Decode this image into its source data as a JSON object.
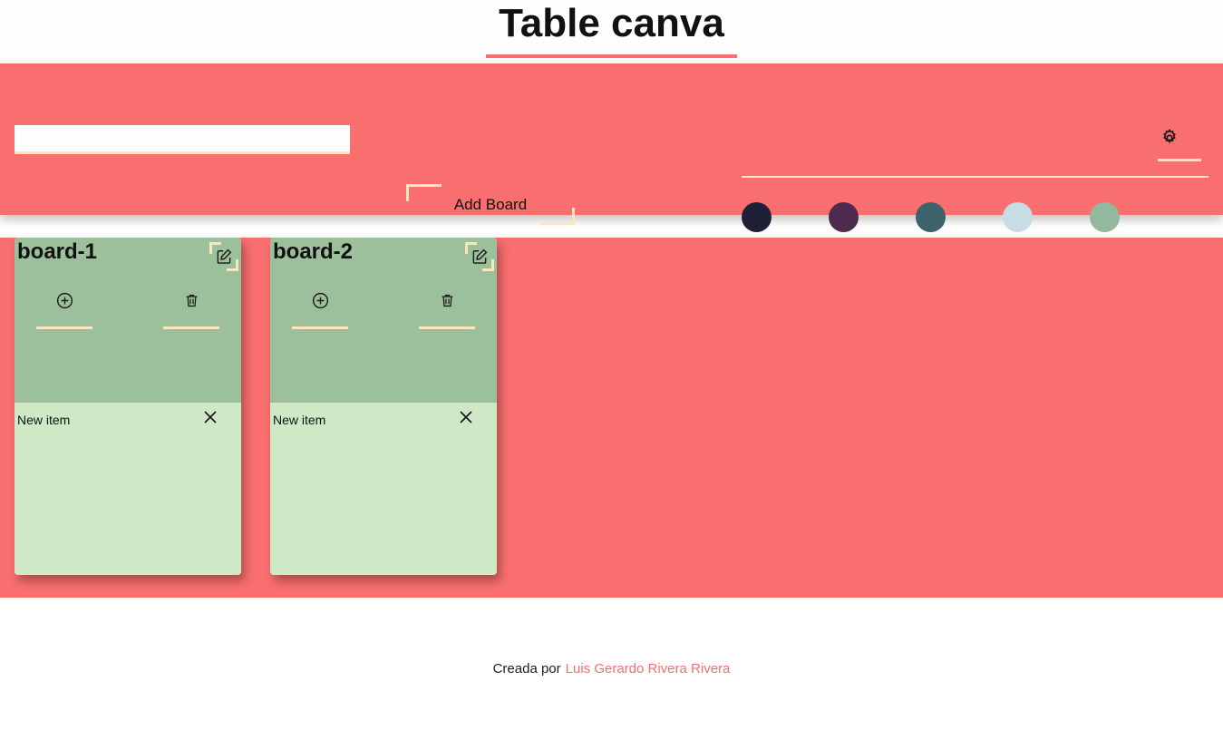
{
  "header": {
    "title": "Table canva"
  },
  "toolbar": {
    "board_name_input": {
      "value": "",
      "placeholder": ""
    },
    "add_board_label": "Add Board",
    "gear_icon": "gear-icon",
    "palette": {
      "colors": [
        {
          "name": "dark-navy",
          "hex": "#1f1f38"
        },
        {
          "name": "dark-purple",
          "hex": "#4d2a4e"
        },
        {
          "name": "teal",
          "hex": "#3c636b"
        },
        {
          "name": "light-blue",
          "hex": "#c6dde4"
        },
        {
          "name": "sage-green",
          "hex": "#93b89e"
        }
      ]
    }
  },
  "canvas": {
    "boards": [
      {
        "title": "board-1",
        "edit_icon": "edit-icon",
        "add_item_icon": "plus-circle-icon",
        "delete_board_icon": "trash-icon",
        "items": [
          {
            "label": "New item",
            "close_icon": "close-icon"
          }
        ]
      },
      {
        "title": "board-2",
        "edit_icon": "edit-icon",
        "add_item_icon": "plus-circle-icon",
        "delete_board_icon": "trash-icon",
        "items": [
          {
            "label": "New item",
            "close_icon": "close-icon"
          }
        ]
      }
    ]
  },
  "footer": {
    "prefix": "Creada por",
    "author": "Luis Gerardo Rivera Rivera"
  },
  "theme": {
    "accent": "#f96e6e",
    "cream": "#fbe6bd",
    "board_head": "#9dc09c",
    "board_body": "#cfe9c7"
  }
}
